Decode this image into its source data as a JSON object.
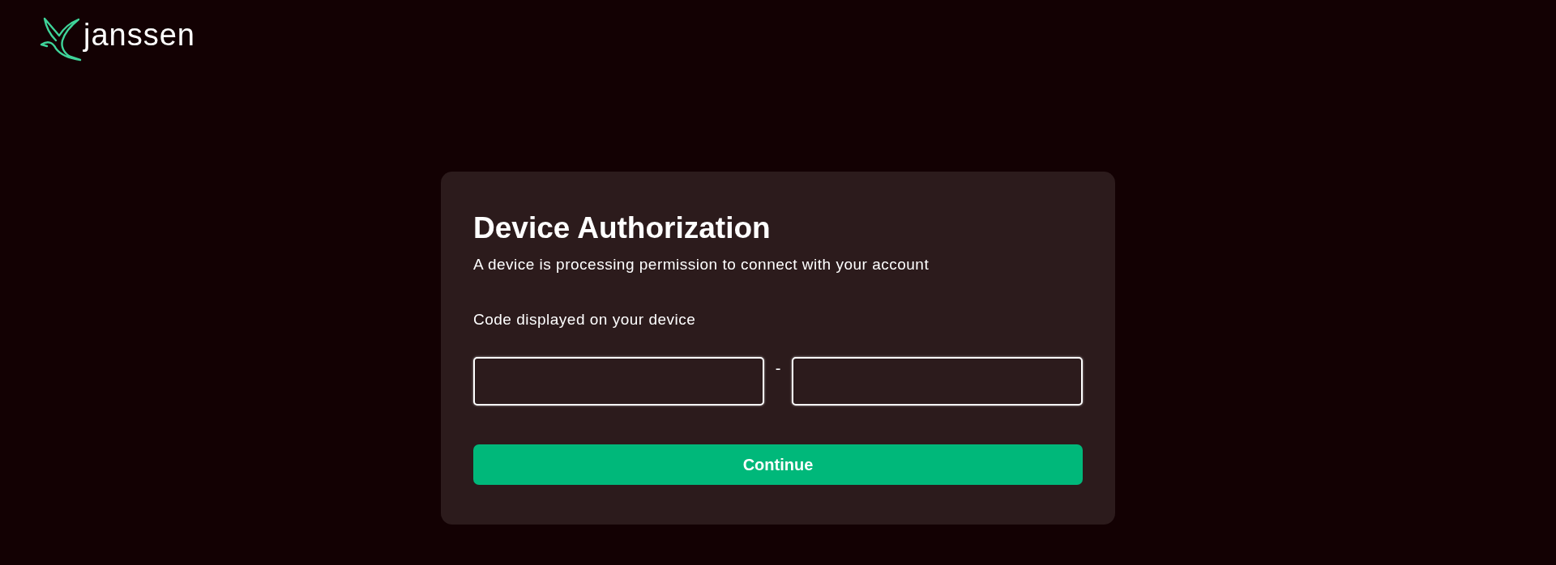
{
  "logo": {
    "text": "janssen"
  },
  "card": {
    "title": "Device Authorization",
    "subtitle": "A device is processing permission to connect with your account",
    "code_label": "Code displayed on your device",
    "code_entry": [
      {
        "kind": "field"
      },
      {
        "kind": "separator",
        "text": "-"
      },
      {
        "kind": "field"
      }
    ],
    "button": {
      "label": "Continue"
    }
  }
}
